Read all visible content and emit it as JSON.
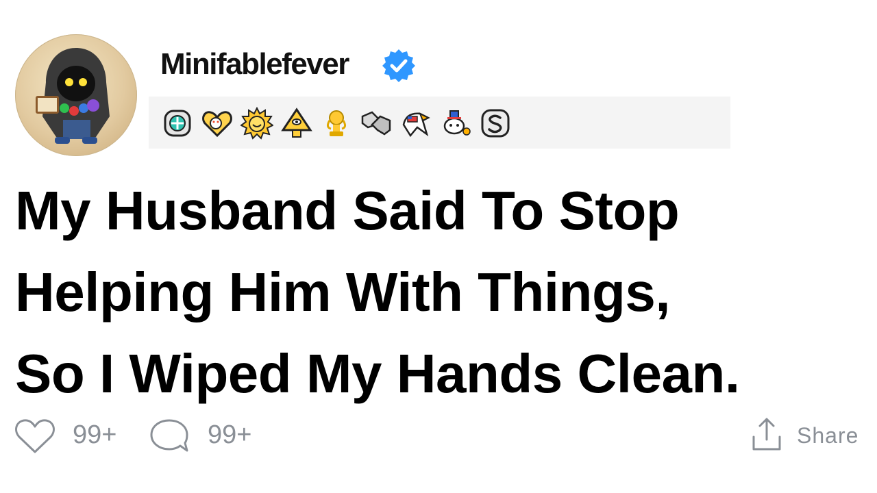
{
  "post": {
    "username": "Minifablefever",
    "title_lines": [
      "My Husband Said To Stop",
      "Helping Him With Things,",
      "So I Wiped My Hands Clean."
    ]
  },
  "awards": [
    {
      "icon": "silver-badge-award-icon"
    },
    {
      "icon": "wholesome-heart-award-icon"
    },
    {
      "icon": "sun-award-icon"
    },
    {
      "icon": "pyramid-award-icon"
    },
    {
      "icon": "gold-trophy-award-icon"
    },
    {
      "icon": "handshake-award-icon"
    },
    {
      "icon": "eagle-award-icon"
    },
    {
      "icon": "snoo-award-icon"
    },
    {
      "icon": "silver-s-award-icon"
    }
  ],
  "actions": {
    "like_count": "99+",
    "comment_count": "99+",
    "share_label": "Share"
  },
  "colors": {
    "verified_blue": "#2f97ff",
    "action_gray": "#8a8f96",
    "award_strip_bg": "#f4f4f4"
  }
}
